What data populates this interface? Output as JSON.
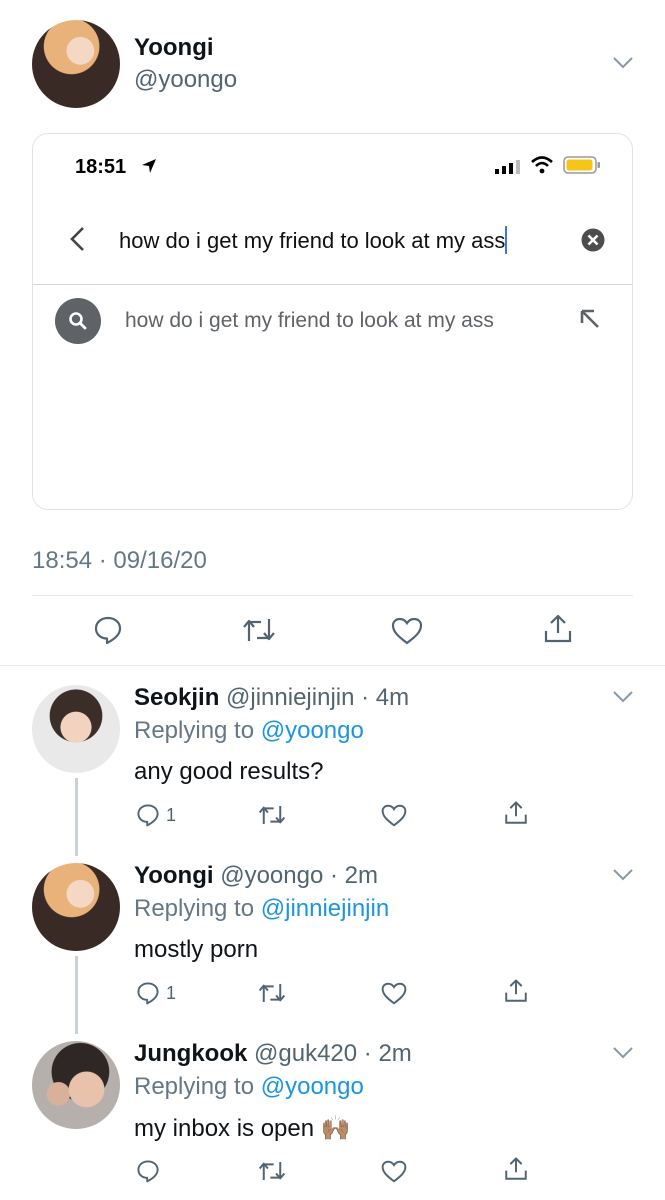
{
  "tweet": {
    "name": "Yoongi",
    "handle": "@yoongo",
    "timestamp": "18:54 · 09/16/20"
  },
  "screenshot": {
    "status_time": "18:51",
    "search_query": "how do i get my friend to look at my ass",
    "suggestion": "how do i get my friend to look at my ass"
  },
  "replies": [
    {
      "name": "Seokjin",
      "handle": "@jinniejinjin",
      "time": "· 4m",
      "replying_prefix": "Replying to",
      "replying_to": "@yoongo",
      "text": "any good results?",
      "reply_count": "1"
    },
    {
      "name": "Yoongi",
      "handle": "@yoongo",
      "time": "· 2m",
      "replying_prefix": "Replying to",
      "replying_to": "@jinniejinjin",
      "text": "mostly porn",
      "reply_count": "1"
    },
    {
      "name": "Jungkook",
      "handle": "@guk420",
      "time": "· 2m",
      "replying_prefix": "Replying to",
      "replying_to": "@yoongo",
      "text": "my inbox is open",
      "emoji": "🙌🏽",
      "reply_count": ""
    }
  ],
  "colors": {
    "link_blue": "#1b95e0",
    "battery_yellow": "#f5c518",
    "cursor_blue": "#3478f6"
  },
  "icons": [
    "chevron-down-icon",
    "location-arrow-icon",
    "signal-icon",
    "wifi-icon",
    "battery-icon",
    "back-icon",
    "clear-icon",
    "search-icon",
    "arrow-up-left-icon",
    "reply-icon",
    "retweet-icon",
    "like-icon",
    "share-icon"
  ]
}
